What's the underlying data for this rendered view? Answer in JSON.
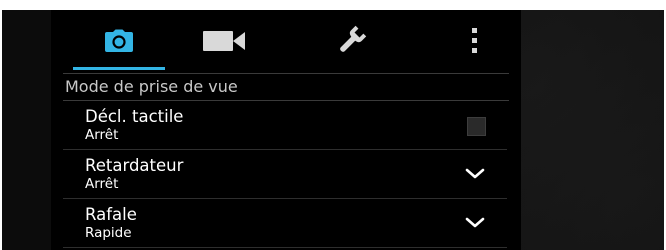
{
  "tabs": [
    {
      "id": "photo",
      "icon": "camera-icon",
      "active": true
    },
    {
      "id": "video",
      "icon": "video-camera-icon",
      "active": false
    },
    {
      "id": "settings",
      "icon": "wrench-icon",
      "active": false
    },
    {
      "id": "more",
      "icon": "more-vert-icon",
      "active": false
    }
  ],
  "accent_color": "#33b5e5",
  "section": {
    "title": "Mode de prise de vue"
  },
  "rows": [
    {
      "title": "Décl. tactile",
      "value": "Arrêt",
      "control": "checkbox",
      "checked": false
    },
    {
      "title": "Retardateur",
      "value": "Arrêt",
      "control": "dropdown"
    },
    {
      "title": "Rafale",
      "value": "Rapide",
      "control": "dropdown"
    }
  ]
}
